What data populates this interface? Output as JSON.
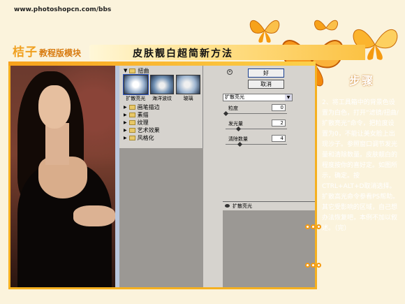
{
  "site_url": "www.photoshopcn.com/bbs",
  "brand": {
    "name": "桔子",
    "suffix": "教程版模块"
  },
  "page_title": "皮肤靓白超简新方法",
  "step_label": "步骤",
  "filter_gallery": {
    "open_category": "扭曲",
    "thumbnails": [
      "扩散亮光",
      "海洋波纹",
      "玻璃"
    ],
    "categories": [
      "画笔描边",
      "素描",
      "纹理",
      "艺术效果",
      "风格化"
    ]
  },
  "settings": {
    "ok_label": "好",
    "cancel_label": "取消",
    "filter_select": "扩散亮光",
    "params": [
      {
        "label": "粒度",
        "value": "0"
      },
      {
        "label": "发光量",
        "value": "2"
      },
      {
        "label": "清除数量",
        "value": "4"
      }
    ],
    "layer_label": "扩散亮光"
  },
  "instructions": "2、将工具箱中的背景色设置为白色，打开“滤镜/扭曲/扩散亮光”命令，把粒度设置为0，不能让美女脸上出现沙子。参照窗口调节发光量和清除数量。皮肤靓白的程度按你的喜好定。如图所示，确定。按CTRL+ALT+D取消选择。扩散高光命令参看PS帮助。其它受影响的区域，自己想办法恢复吧，本例不加以叙述。（完）",
  "colors": {
    "accent": "#f5a020",
    "panel": "#d6d3ce",
    "background": "#fbf3dc"
  }
}
